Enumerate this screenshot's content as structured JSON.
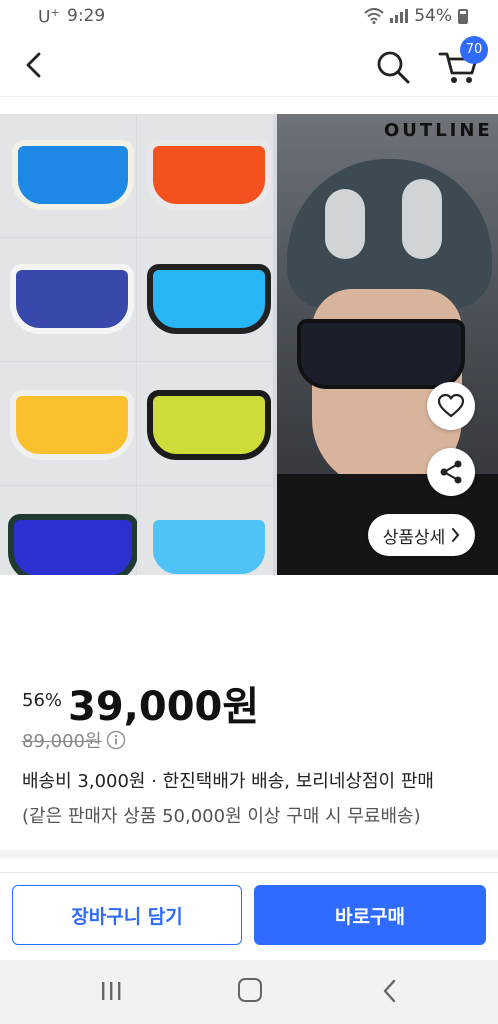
{
  "status_bar": {
    "carrier": "U",
    "carrier_sup": "+",
    "time": "9:29",
    "battery": "54%"
  },
  "header": {
    "cart_count": "70",
    "icons": [
      "back-arrow-icon",
      "search-icon",
      "cart-icon"
    ]
  },
  "hero": {
    "brand": "OUTLINE",
    "detail_button": "상품상세",
    "lens_colors": [
      "#1e88e5",
      "#f4511e",
      "#3949ab",
      "#29b6f6",
      "#fbc02d",
      "#cddc39",
      "#2d2fd0",
      "#4fc3f7"
    ],
    "frame_colors": [
      "#f1f1e4",
      "#e8e8e8",
      "#f5f5f5",
      "#222222",
      "#f0f0f0",
      "#1b1b1b",
      "#1f3a30",
      "#e4e4e4"
    ]
  },
  "price": {
    "discount": "56%",
    "sale_price": "39,000원",
    "original_price": "89,000원"
  },
  "shipping": {
    "line1": "배송비 3,000원 · 한진택배가 배송, 보리네상점이 판매",
    "line2": "(같은 판매자 상품 50,000원 이상 구매 시 무료배송)"
  },
  "actions": {
    "add_to_cart": "장바구니 담기",
    "buy_now": "바로구매"
  },
  "colors": {
    "accent": "#2f6bff"
  }
}
